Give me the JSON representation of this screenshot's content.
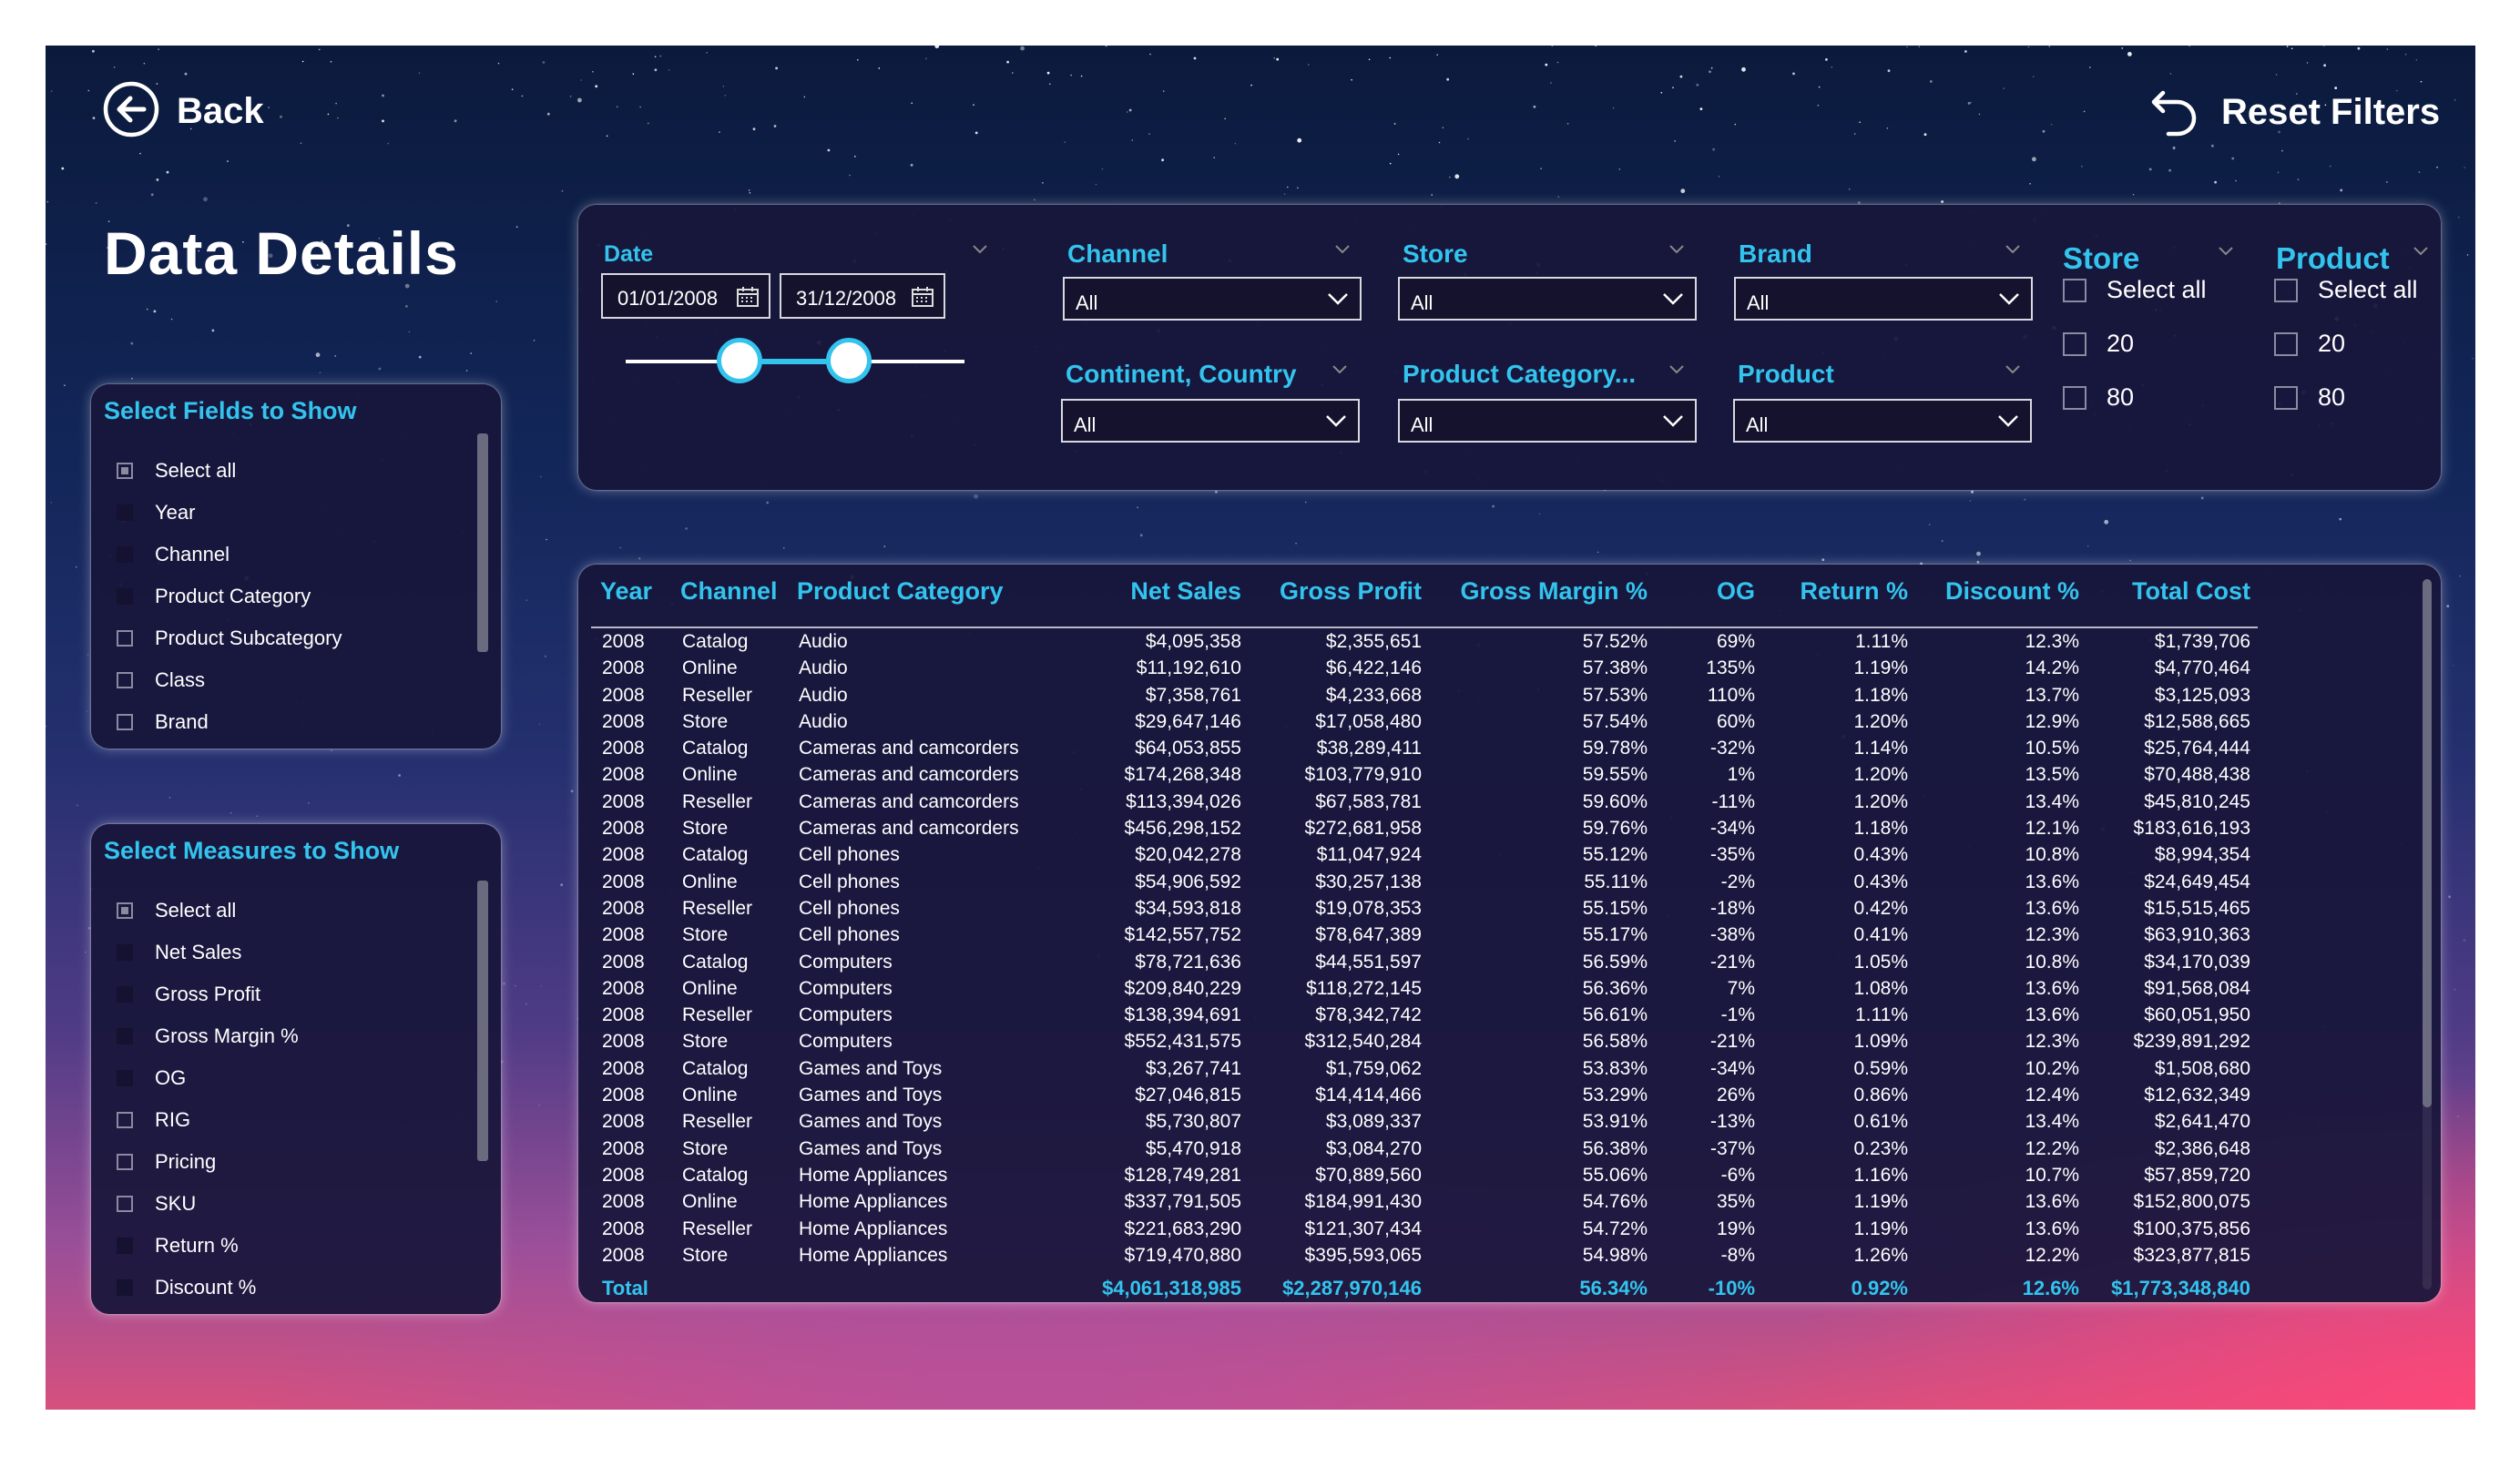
{
  "nav": {
    "back_label": "Back",
    "reset_label": "Reset Filters"
  },
  "page_title": "Data Details",
  "fields_panel": {
    "title": "Select Fields to Show",
    "items": [
      {
        "label": "Select all",
        "state": "partial"
      },
      {
        "label": "Year",
        "state": "checked"
      },
      {
        "label": "Channel",
        "state": "checked"
      },
      {
        "label": "Product Category",
        "state": "checked"
      },
      {
        "label": "Product Subcategory",
        "state": "unchecked"
      },
      {
        "label": "Class",
        "state": "unchecked"
      },
      {
        "label": "Brand",
        "state": "unchecked"
      }
    ]
  },
  "measures_panel": {
    "title": "Select Measures to Show",
    "items": [
      {
        "label": "Select all",
        "state": "partial"
      },
      {
        "label": "Net Sales",
        "state": "checked"
      },
      {
        "label": "Gross Profit",
        "state": "checked"
      },
      {
        "label": "Gross Margin %",
        "state": "checked"
      },
      {
        "label": "OG",
        "state": "checked"
      },
      {
        "label": "RIG",
        "state": "unchecked"
      },
      {
        "label": "Pricing",
        "state": "unchecked"
      },
      {
        "label": "SKU",
        "state": "unchecked"
      },
      {
        "label": "Return %",
        "state": "checked"
      },
      {
        "label": "Discount %",
        "state": "checked"
      }
    ]
  },
  "filters": {
    "date": {
      "label": "Date",
      "start": "01/01/2008",
      "end": "31/12/2008"
    },
    "channel": {
      "label": "Channel",
      "value": "All"
    },
    "store": {
      "label": "Store",
      "value": "All"
    },
    "brand": {
      "label": "Brand",
      "value": "All"
    },
    "continent": {
      "label": "Continent, Country",
      "value": "All"
    },
    "product_category": {
      "label": "Product Category...",
      "value": "All"
    },
    "product": {
      "label": "Product",
      "value": "All"
    },
    "store_slicer": {
      "title": "Store",
      "options": [
        "Select all",
        "20",
        "80"
      ]
    },
    "product_slicer": {
      "title": "Product",
      "options": [
        "Select all",
        "20",
        "80"
      ]
    }
  },
  "table": {
    "columns": [
      "Year",
      "Channel",
      "Product Category",
      "Net Sales",
      "Gross Profit",
      "Gross Margin %",
      "OG",
      "Return %",
      "Discount %",
      "Total Cost"
    ],
    "rows": [
      [
        "2008",
        "Catalog",
        "Audio",
        "$4,095,358",
        "$2,355,651",
        "57.52%",
        "69%",
        "1.11%",
        "12.3%",
        "$1,739,706"
      ],
      [
        "2008",
        "Online",
        "Audio",
        "$11,192,610",
        "$6,422,146",
        "57.38%",
        "135%",
        "1.19%",
        "14.2%",
        "$4,770,464"
      ],
      [
        "2008",
        "Reseller",
        "Audio",
        "$7,358,761",
        "$4,233,668",
        "57.53%",
        "110%",
        "1.18%",
        "13.7%",
        "$3,125,093"
      ],
      [
        "2008",
        "Store",
        "Audio",
        "$29,647,146",
        "$17,058,480",
        "57.54%",
        "60%",
        "1.20%",
        "12.9%",
        "$12,588,665"
      ],
      [
        "2008",
        "Catalog",
        "Cameras and camcorders",
        "$64,053,855",
        "$38,289,411",
        "59.78%",
        "-32%",
        "1.14%",
        "10.5%",
        "$25,764,444"
      ],
      [
        "2008",
        "Online",
        "Cameras and camcorders",
        "$174,268,348",
        "$103,779,910",
        "59.55%",
        "1%",
        "1.20%",
        "13.5%",
        "$70,488,438"
      ],
      [
        "2008",
        "Reseller",
        "Cameras and camcorders",
        "$113,394,026",
        "$67,583,781",
        "59.60%",
        "-11%",
        "1.20%",
        "13.4%",
        "$45,810,245"
      ],
      [
        "2008",
        "Store",
        "Cameras and camcorders",
        "$456,298,152",
        "$272,681,958",
        "59.76%",
        "-34%",
        "1.18%",
        "12.1%",
        "$183,616,193"
      ],
      [
        "2008",
        "Catalog",
        "Cell phones",
        "$20,042,278",
        "$11,047,924",
        "55.12%",
        "-35%",
        "0.43%",
        "10.8%",
        "$8,994,354"
      ],
      [
        "2008",
        "Online",
        "Cell phones",
        "$54,906,592",
        "$30,257,138",
        "55.11%",
        "-2%",
        "0.43%",
        "13.6%",
        "$24,649,454"
      ],
      [
        "2008",
        "Reseller",
        "Cell phones",
        "$34,593,818",
        "$19,078,353",
        "55.15%",
        "-18%",
        "0.42%",
        "13.6%",
        "$15,515,465"
      ],
      [
        "2008",
        "Store",
        "Cell phones",
        "$142,557,752",
        "$78,647,389",
        "55.17%",
        "-38%",
        "0.41%",
        "12.3%",
        "$63,910,363"
      ],
      [
        "2008",
        "Catalog",
        "Computers",
        "$78,721,636",
        "$44,551,597",
        "56.59%",
        "-21%",
        "1.05%",
        "10.8%",
        "$34,170,039"
      ],
      [
        "2008",
        "Online",
        "Computers",
        "$209,840,229",
        "$118,272,145",
        "56.36%",
        "7%",
        "1.08%",
        "13.6%",
        "$91,568,084"
      ],
      [
        "2008",
        "Reseller",
        "Computers",
        "$138,394,691",
        "$78,342,742",
        "56.61%",
        "-1%",
        "1.11%",
        "13.6%",
        "$60,051,950"
      ],
      [
        "2008",
        "Store",
        "Computers",
        "$552,431,575",
        "$312,540,284",
        "56.58%",
        "-21%",
        "1.09%",
        "12.3%",
        "$239,891,292"
      ],
      [
        "2008",
        "Catalog",
        "Games and Toys",
        "$3,267,741",
        "$1,759,062",
        "53.83%",
        "-34%",
        "0.59%",
        "10.2%",
        "$1,508,680"
      ],
      [
        "2008",
        "Online",
        "Games and Toys",
        "$27,046,815",
        "$14,414,466",
        "53.29%",
        "26%",
        "0.86%",
        "12.4%",
        "$12,632,349"
      ],
      [
        "2008",
        "Reseller",
        "Games and Toys",
        "$5,730,807",
        "$3,089,337",
        "53.91%",
        "-13%",
        "0.61%",
        "13.4%",
        "$2,641,470"
      ],
      [
        "2008",
        "Store",
        "Games and Toys",
        "$5,470,918",
        "$3,084,270",
        "56.38%",
        "-37%",
        "0.23%",
        "12.2%",
        "$2,386,648"
      ],
      [
        "2008",
        "Catalog",
        "Home Appliances",
        "$128,749,281",
        "$70,889,560",
        "55.06%",
        "-6%",
        "1.16%",
        "10.7%",
        "$57,859,720"
      ],
      [
        "2008",
        "Online",
        "Home Appliances",
        "$337,791,505",
        "$184,991,430",
        "54.76%",
        "35%",
        "1.19%",
        "13.6%",
        "$152,800,075"
      ],
      [
        "2008",
        "Reseller",
        "Home Appliances",
        "$221,683,290",
        "$121,307,434",
        "54.72%",
        "19%",
        "1.19%",
        "13.6%",
        "$100,375,856"
      ],
      [
        "2008",
        "Store",
        "Home Appliances",
        "$719,470,880",
        "$395,593,065",
        "54.98%",
        "-8%",
        "1.26%",
        "12.2%",
        "$323,877,815"
      ]
    ],
    "total": [
      "Total",
      "",
      "",
      "$4,061,318,985",
      "$2,287,970,146",
      "56.34%",
      "-10%",
      "0.92%",
      "12.6%",
      "$1,773,348,840"
    ]
  }
}
